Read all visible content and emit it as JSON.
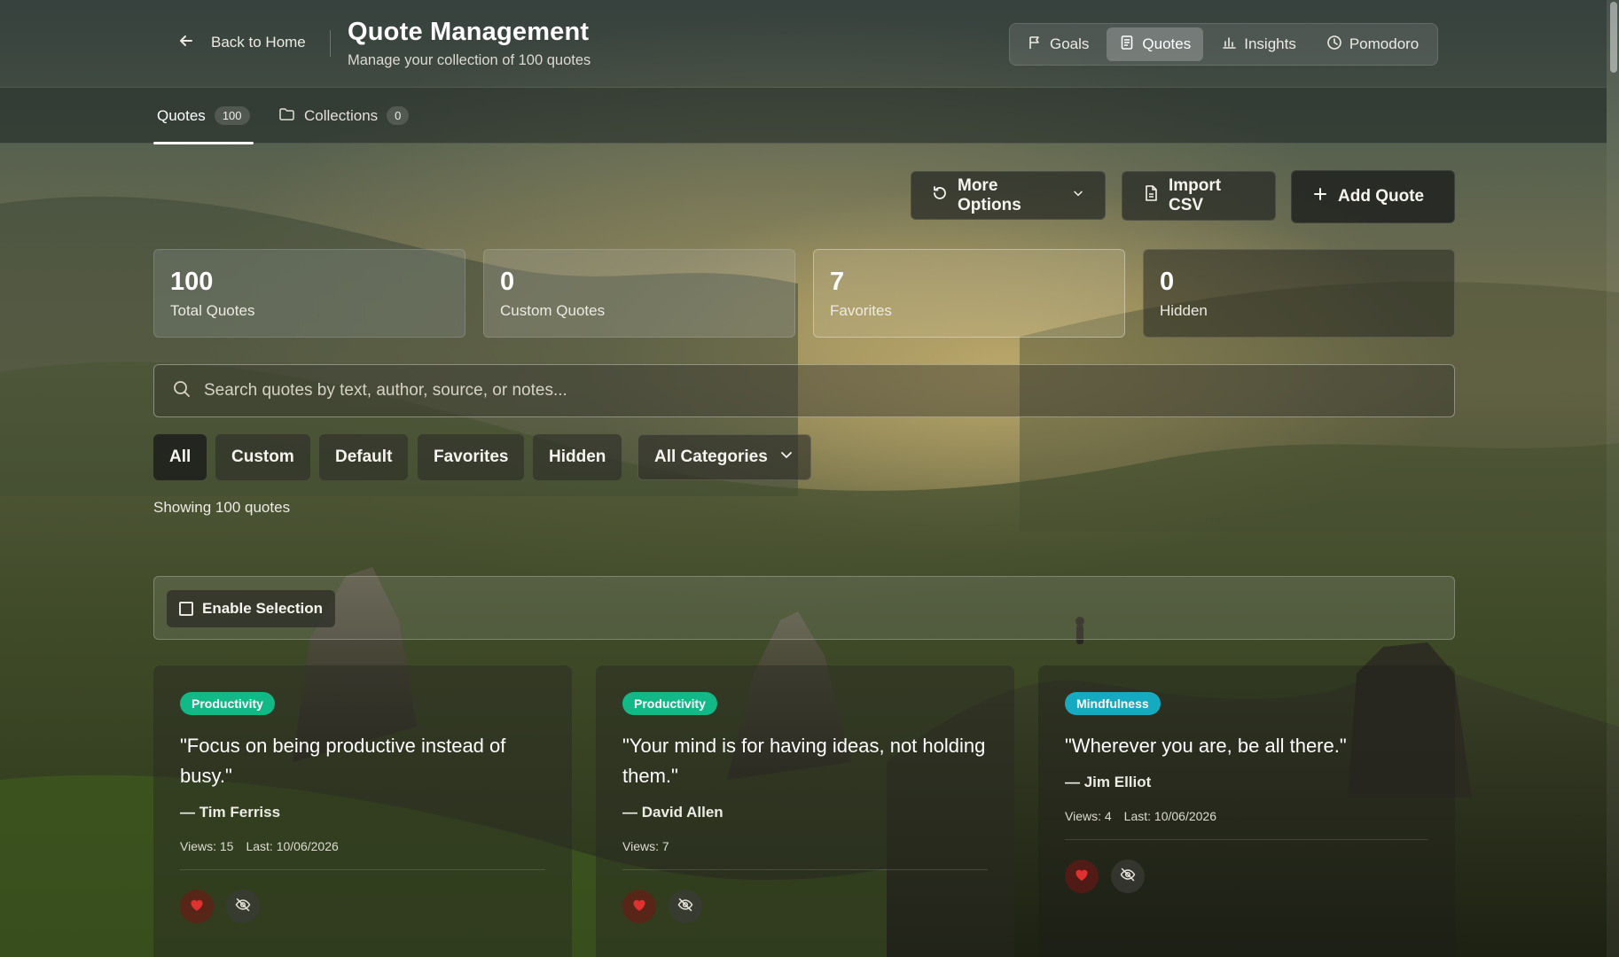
{
  "header": {
    "back_label": "Back to Home",
    "title": "Quote Management",
    "subtitle": "Manage your collection of 100 quotes",
    "nav": [
      {
        "label": "Goals",
        "icon": "flag-icon"
      },
      {
        "label": "Quotes",
        "icon": "document-icon",
        "active": true
      },
      {
        "label": "Insights",
        "icon": "bar-chart-icon"
      },
      {
        "label": "Pomodoro",
        "icon": "clock-icon"
      }
    ]
  },
  "tabs": [
    {
      "label": "Quotes",
      "count": "100",
      "active": true
    },
    {
      "label": "Collections",
      "count": "0",
      "icon": "folder-icon"
    }
  ],
  "actions": {
    "more_options": "More Options",
    "import_csv": "Import CSV",
    "add_quote": "Add Quote"
  },
  "stats": [
    {
      "value": "100",
      "label": "Total Quotes"
    },
    {
      "value": "0",
      "label": "Custom Quotes"
    },
    {
      "value": "7",
      "label": "Favorites"
    },
    {
      "value": "0",
      "label": "Hidden"
    }
  ],
  "search": {
    "placeholder": "Search quotes by text, author, source, or notes...",
    "value": ""
  },
  "filters": [
    {
      "label": "All",
      "active": true
    },
    {
      "label": "Custom"
    },
    {
      "label": "Default"
    },
    {
      "label": "Favorites"
    },
    {
      "label": "Hidden"
    }
  ],
  "category_select": "All Categories",
  "showing_text": "Showing 100 quotes",
  "selection": {
    "label": "Enable Selection"
  },
  "quotes": [
    {
      "category": "Productivity",
      "category_color": "#12b886",
      "text": "\"Focus on being productive instead of busy.\"",
      "author": "— Tim Ferriss",
      "views": "Views: 15",
      "last": "Last: 10/06/2026"
    },
    {
      "category": "Productivity",
      "category_color": "#12b886",
      "text": "\"Your mind is for having ideas, not holding them.\"",
      "author": "— David Allen",
      "views": "Views: 7",
      "last": ""
    },
    {
      "category": "Mindfulness",
      "category_color": "#15aabf",
      "text": "\"Wherever you are, be all there.\"",
      "author": "— Jim Elliot",
      "views": "Views: 4",
      "last": "Last: 10/06/2026"
    }
  ],
  "colors": {
    "favorite": "#e03131",
    "accent_green": "#12b886",
    "accent_cyan": "#15aabf"
  }
}
